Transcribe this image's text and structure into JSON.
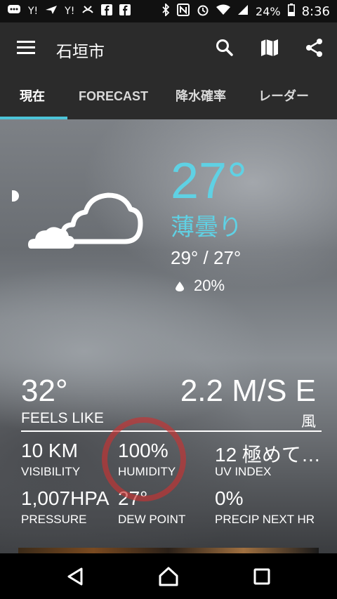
{
  "status_bar": {
    "battery": "24%",
    "time": "8:36",
    "icons": [
      "chat-icon",
      "yahoo-icon",
      "send-icon",
      "yahoo-icon",
      "missed-call-icon",
      "facebook-icon",
      "facebook-icon",
      "bluetooth-icon",
      "nfc-icon",
      "alarm-icon",
      "wifi-icon",
      "signal-icon",
      "battery-icon"
    ],
    "left_labels": [
      "Y!",
      "Y!"
    ]
  },
  "app_bar": {
    "title": "石垣市",
    "actions": [
      "search-icon",
      "map-icon",
      "share-icon"
    ]
  },
  "tabs": [
    {
      "label": "現在",
      "active": true
    },
    {
      "label": "FORECAST",
      "active": false
    },
    {
      "label": "降水確率",
      "active": false
    },
    {
      "label": "レーダー",
      "active": false
    }
  ],
  "current": {
    "temperature": "27°",
    "condition": "薄曇り",
    "hi_lo": "29° / 27°",
    "precip_chance": "20%"
  },
  "details": {
    "feels_like": {
      "value": "32°",
      "label": "FEELS LIKE"
    },
    "wind": {
      "value": "2.2 M/S E",
      "label": "風"
    },
    "visibility": {
      "value": "10 KM",
      "label": "VISIBILITY"
    },
    "humidity": {
      "value": "100%",
      "label": "HUMIDITY"
    },
    "uv_index": {
      "value": "12 極めて…",
      "label": "UV INDEX"
    },
    "pressure": {
      "value": "1,007HPA",
      "label": "PRESSURE"
    },
    "dew_point": {
      "value": "27°",
      "label": "DEW POINT"
    },
    "precip_next_hr": {
      "value": "0%",
      "label": "PRECIP NEXT HR"
    }
  },
  "colors": {
    "accent": "#5fd1e4",
    "app_bar": "#2b2b2b",
    "highlight": "#c83232"
  }
}
